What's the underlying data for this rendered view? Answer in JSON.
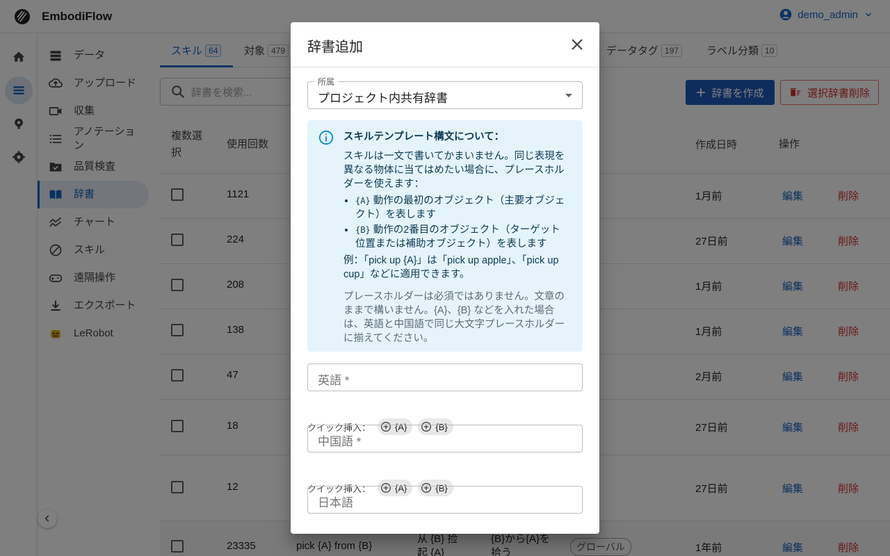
{
  "app": {
    "title": "EmbodiFlow",
    "user": "demo_admin"
  },
  "sidebar": {
    "items": [
      {
        "label": "データ",
        "icon": "database-icon"
      },
      {
        "label": "アップロード",
        "icon": "cloud-upload-icon"
      },
      {
        "label": "収集",
        "icon": "video-camera-icon"
      },
      {
        "label": "アノテーション",
        "icon": "list-icon"
      },
      {
        "label": "品質検査",
        "icon": "folder-check-icon"
      },
      {
        "label": "辞書",
        "icon": "book-icon"
      },
      {
        "label": "チャート",
        "icon": "chart-icon"
      },
      {
        "label": "スキル",
        "icon": "skill-icon"
      },
      {
        "label": "遠隔操作",
        "icon": "gamepad-icon"
      },
      {
        "label": "エクスポート",
        "icon": "download-icon"
      },
      {
        "label": "LeRobot",
        "icon": "robot-icon"
      }
    ]
  },
  "tabs": [
    {
      "label": "スキル",
      "count": "64"
    },
    {
      "label": "対象",
      "count": "479"
    },
    {
      "label": "データタグ",
      "count": "197"
    },
    {
      "label": "ラベル分類",
      "count": "10"
    }
  ],
  "toolbar": {
    "search_placeholder": "辞書を検索...",
    "create_label": "辞書を作成",
    "delete_selected_label": "選択辞書削除"
  },
  "table": {
    "headers": {
      "multi_select": "複数選択",
      "usage": "使用回数",
      "created": "作成日時",
      "actions": "操作"
    },
    "edit_label": "編集",
    "delete_label": "削除",
    "rows": [
      {
        "usage": "1121",
        "created": "1月前"
      },
      {
        "usage": "224",
        "created": "27日前"
      },
      {
        "usage": "208",
        "created": "1月前"
      },
      {
        "usage": "138",
        "created": "1月前"
      },
      {
        "usage": "47",
        "created": "2月前"
      },
      {
        "usage": "18",
        "created": "27日前"
      },
      {
        "usage": "12",
        "created": "27日前"
      },
      {
        "usage": "23335",
        "english": "pick {A} from {B}",
        "chinese": "从 {B} 捡起 {A}",
        "japanese": "{B}から{A}を拾う",
        "scope": "グローバル",
        "created": "1年前"
      }
    ]
  },
  "dialog": {
    "title": "辞書追加",
    "scope": {
      "legend": "所属",
      "value": "プロジェクト内共有辞書"
    },
    "info": {
      "title": "スキルテンプレート構文について：",
      "p1": "スキルは一文で書いてかまいません。同じ表現を異なる物体に当てはめたい場合に、プレースホルダーを使えます：",
      "bullet1_code": "{A}",
      "bullet1_text": "動作の最初のオブジェクト（主要オブジェクト）を表します",
      "bullet2_code": "{B}",
      "bullet2_text": "動作の2番目のオブジェクト（ターゲット位置または補助オブジェクト）を表します",
      "example": "例：「pick up {A}」は「pick up apple」、「pick up cup」などに適用できます。",
      "note": "プレースホルダーは必須ではありません。文章のままで構いません。{A}、{B} などを入れた場合は、英語と中国語で同じ大文字プレースホルダーに揃えてください。"
    },
    "fields": {
      "english": "英語 *",
      "chinese": "中国語 *",
      "japanese": "日本語"
    },
    "quick_insert_label": "クイック挿入：",
    "chip_a": "{A}",
    "chip_b": "{B}"
  },
  "colors": {
    "accent": "#1565c0",
    "danger": "#d32f2f",
    "info_bg": "#e5f4fb"
  }
}
